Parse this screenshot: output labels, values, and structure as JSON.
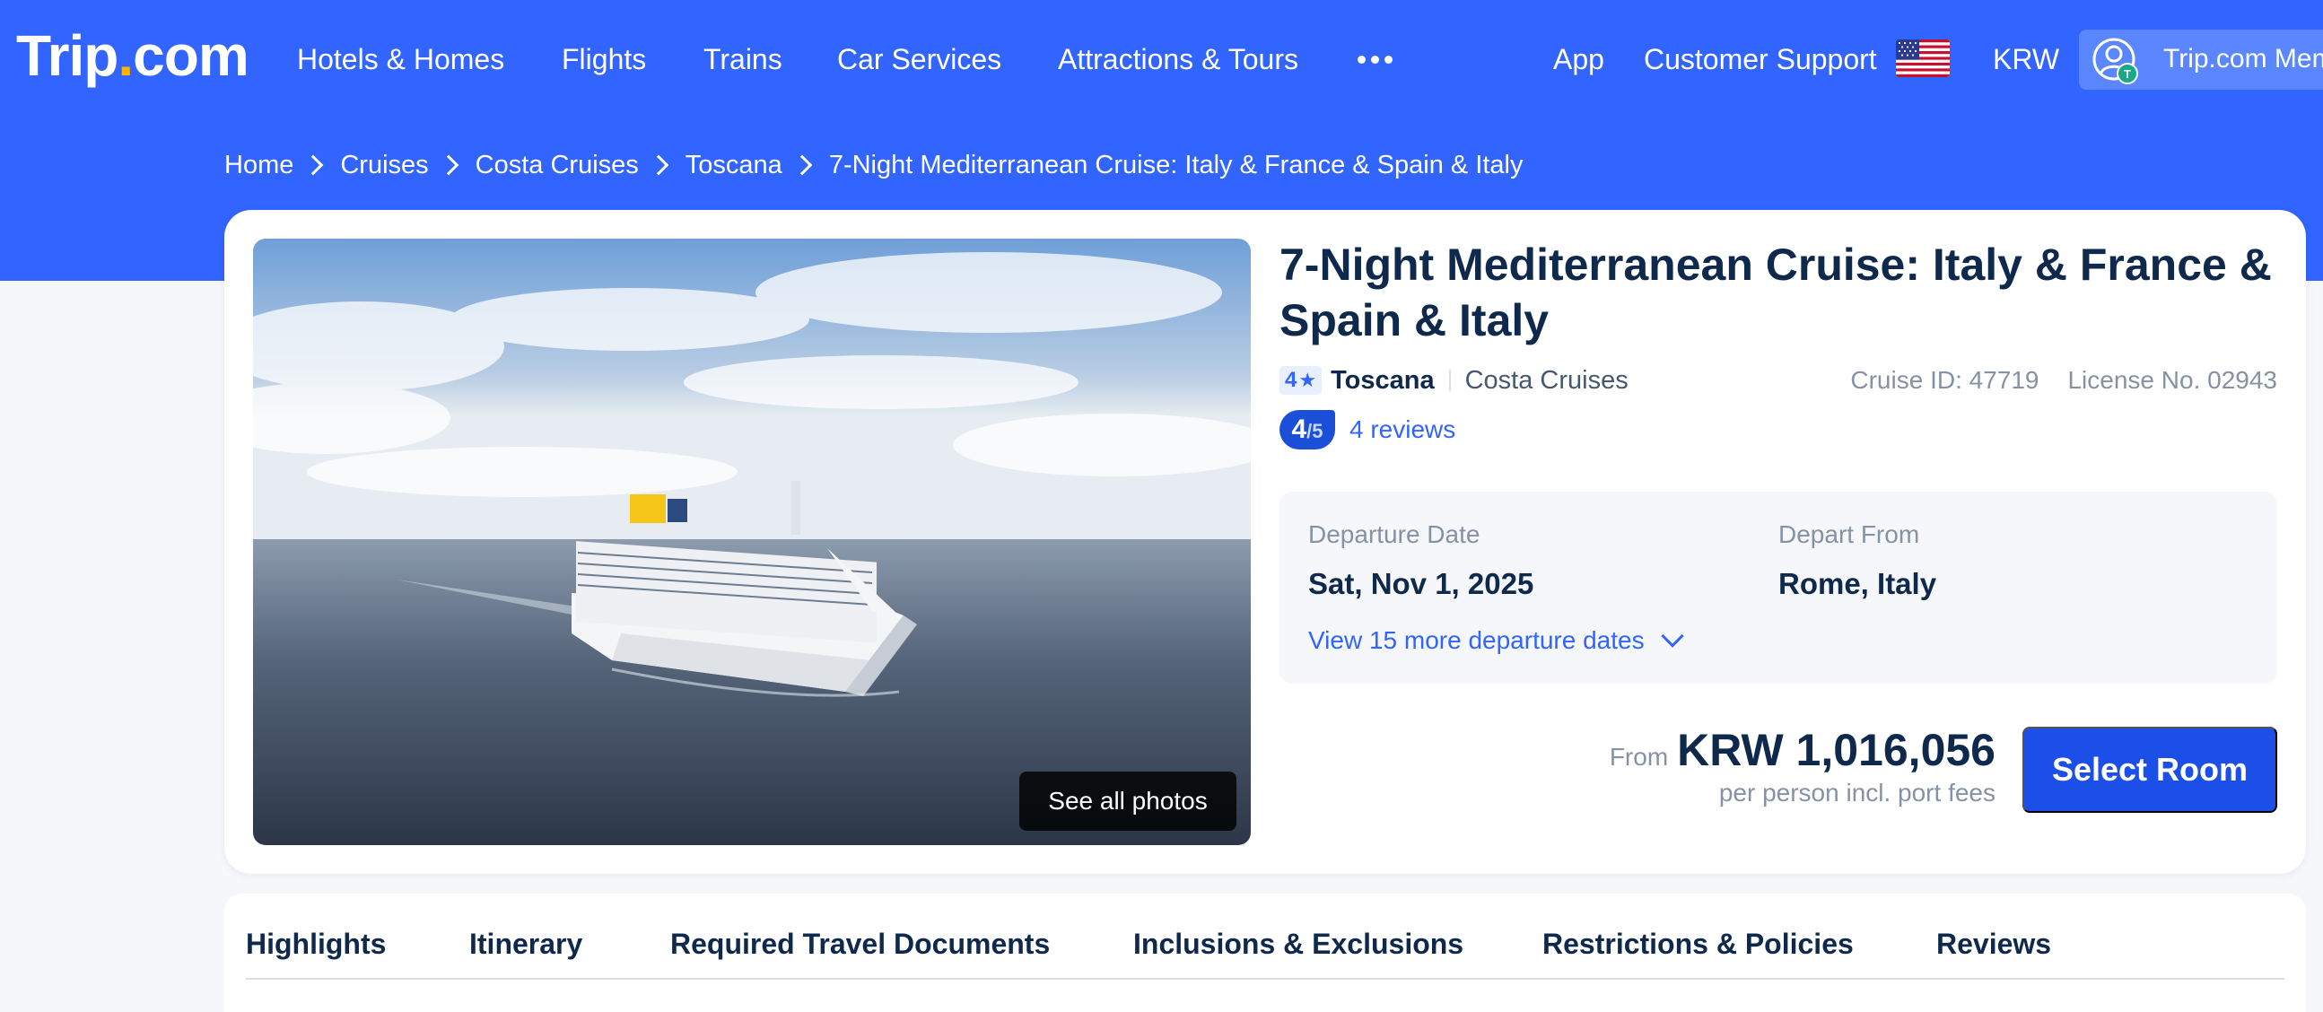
{
  "brand": {
    "logo_main": "Trip",
    "logo_dot": ".",
    "logo_suffix": "com"
  },
  "nav": {
    "items": [
      "Hotels & Homes",
      "Flights",
      "Trains",
      "Car Services",
      "Attractions & Tours"
    ],
    "more_icon": "more-dots-icon",
    "right": {
      "app": "App",
      "support": "Customer Support",
      "flag_icon": "us-flag-icon",
      "currency": "KRW",
      "member": "Trip.com Member"
    }
  },
  "breadcrumb": [
    "Home",
    "Cruises",
    "Costa Cruises",
    "Toscana",
    "7-Night Mediterranean Cruise: Italy & France & Spain & Italy"
  ],
  "cruise": {
    "title": "7-Night Mediterranean Cruise: Italy & France & Spain & Italy",
    "stars": "4",
    "ship": "Toscana",
    "cruise_line": "Costa Cruises",
    "cruise_id": "Cruise ID: 47719",
    "license": "License No. 02943",
    "score": "4",
    "score_max": "/5",
    "reviews": "4 reviews",
    "see_photos": "See all photos"
  },
  "departure": {
    "date_label": "Departure Date",
    "date_value": "Sat, Nov 1, 2025",
    "from_label": "Depart From",
    "from_value": "Rome, Italy",
    "more_dates": "View 15 more departure dates"
  },
  "price": {
    "from": "From",
    "amount": "KRW 1,016,056",
    "note": "per person incl. port fees",
    "cta": "Select Room"
  },
  "tabs": [
    "Highlights",
    "Itinerary",
    "Required Travel Documents",
    "Inclusions & Exclusions",
    "Restrictions & Policies",
    "Reviews"
  ],
  "colors": {
    "brand_blue": "#3264ff",
    "cta_blue": "#1b4fe8",
    "text_dark": "#0f294d",
    "muted": "#8592a6",
    "logo_dot": "#ffb400"
  }
}
